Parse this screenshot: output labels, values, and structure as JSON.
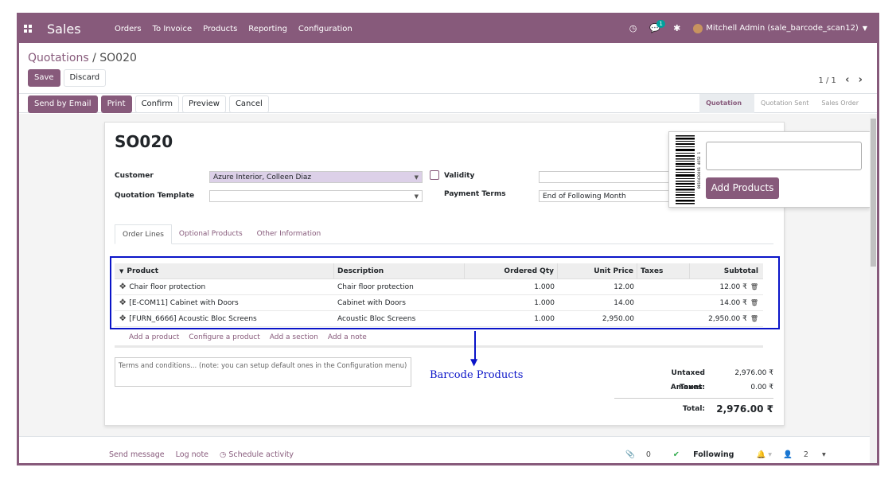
{
  "navbar": {
    "app_name": "Sales",
    "menu": [
      "Orders",
      "To Invoice",
      "Products",
      "Reporting",
      "Configuration"
    ],
    "chat_badge": "1",
    "user": "Mitchell Admin (sale_barcode_scan12)",
    "color": "#875a7b"
  },
  "breadcrumb": {
    "parent": "Quotations",
    "separator": " / ",
    "current": "SO020"
  },
  "cp": {
    "save": "Save",
    "discard": "Discard"
  },
  "pager": {
    "value": "1 / 1",
    "prev": "‹",
    "next": "›"
  },
  "statusbar": {
    "buttons": [
      "Send by Email",
      "Print",
      "Confirm",
      "Preview",
      "Cancel"
    ],
    "stages": [
      "Quotation",
      "Quotation Sent",
      "Sales Order"
    ]
  },
  "form": {
    "name": "SO020",
    "customer_label": "Customer",
    "customer_value": "Azure Interior, Colleen Diaz",
    "template_label": "Quotation Template",
    "template_value": "",
    "validity_label": "Validity",
    "validity_value": "",
    "terms_label": "Payment Terms",
    "terms_value": "End of Following Month"
  },
  "tabs": [
    "Order Lines",
    "Optional Products",
    "Other Information"
  ],
  "table": {
    "headers": [
      "Product",
      "Description",
      "Ordered Qty",
      "Unit Price",
      "Taxes",
      "Subtotal"
    ],
    "rows": [
      {
        "product": "Chair floor protection",
        "description": "Chair floor protection",
        "qty": "1.000",
        "price": "12.00",
        "taxes": "",
        "subtotal": "12.00 ₹"
      },
      {
        "product": "[E-COM11] Cabinet with Doors",
        "description": "Cabinet with Doors",
        "qty": "1.000",
        "price": "14.00",
        "taxes": "",
        "subtotal": "14.00 ₹"
      },
      {
        "product": "[FURN_6666] Acoustic Bloc Screens",
        "description": "Acoustic Bloc Screens",
        "qty": "1.000",
        "price": "2,950.00",
        "taxes": "",
        "subtotal": "2,950.00 ₹"
      }
    ],
    "add_links": [
      "Add a product",
      "Configure a product",
      "Add a section",
      "Add a note"
    ]
  },
  "terms_placeholder": "Terms and conditions... (note: you can setup default ones in the Configuration menu)",
  "annotation": "Barcode  Products",
  "totals": {
    "untaxed_label": "Untaxed Amount:",
    "untaxed_value": "2,976.00 ₹",
    "taxes_label": "Taxes:",
    "taxes_value": "0.00 ₹",
    "total_label": "Total:",
    "total_value": "2,976.00 ₹"
  },
  "barcode_panel": {
    "barcode_digits": "0016420491 4652 1",
    "button": "Add Products"
  },
  "chatter": {
    "send_message": "Send message",
    "log_note": "Log note",
    "schedule": "Schedule activity",
    "attachments": "0",
    "following": "Following",
    "followers": "2"
  }
}
